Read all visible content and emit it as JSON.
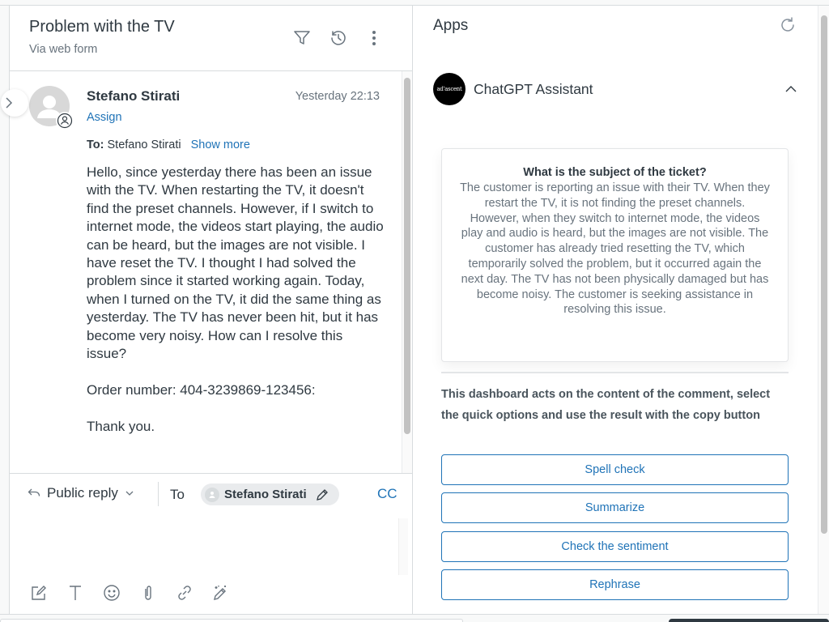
{
  "ticket": {
    "title": "Problem with the TV",
    "channel": "Via web form",
    "header_icons": [
      "filter-icon",
      "history-icon",
      "more-options-icon"
    ]
  },
  "comment": {
    "author": "Stefano Stirati",
    "timestamp": "Yesterday 22:13",
    "assign_label": "Assign",
    "to_label": "To:",
    "to_name": "Stefano Stirati",
    "show_more_label": "Show more",
    "body": "Hello, since yesterday there has been an issue with the TV. When restarting the TV, it doesn't find the preset channels. However, if I switch to internet mode, the videos start playing, the audio can be heard, but the images are not visible. I have reset the TV. I thought I had solved the problem since it started working again. Today, when I turned on the TV, it did the same thing as yesterday. The TV has never been hit, but it has become very noisy. How can I resolve this issue?\n\nOrder number: 404-3239869-123456:\n\nThank you."
  },
  "reply": {
    "type_label": "Public reply",
    "to_label": "To",
    "recipient": "Stefano Stirati",
    "cc_label": "CC",
    "input_value": "",
    "toolbar_icons": [
      "compose-icon",
      "text-format-icon",
      "emoji-icon",
      "attachment-icon",
      "link-icon",
      "magic-wand-icon"
    ]
  },
  "apps": {
    "title": "Apps",
    "app": {
      "name": "ChatGPT Assistant",
      "logo_text": "ad'ascent",
      "expanded": true
    },
    "summary": {
      "question": "What is the subject of the ticket?",
      "answer": "The customer is reporting an issue with their TV. When they restart the TV, it is not finding the preset channels. However, when they switch to internet mode, the videos play and audio is heard, but the images are not visible. The customer has already tried resetting the TV, which temporarily solved the problem, but it occurred again the next day. The TV has not been physically damaged but has become noisy. The customer is seeking assistance in resolving this issue."
    },
    "description": "This dashboard acts on the content of the comment, select the quick options and use the result with the copy button",
    "actions": [
      {
        "label": "Spell check"
      },
      {
        "label": "Summarize"
      },
      {
        "label": "Check the sentiment"
      },
      {
        "label": "Rephrase"
      }
    ]
  },
  "colors": {
    "accent": "#1f73b7",
    "text_primary": "#2f3941",
    "text_secondary": "#68737d",
    "border": "#d8dcde"
  }
}
